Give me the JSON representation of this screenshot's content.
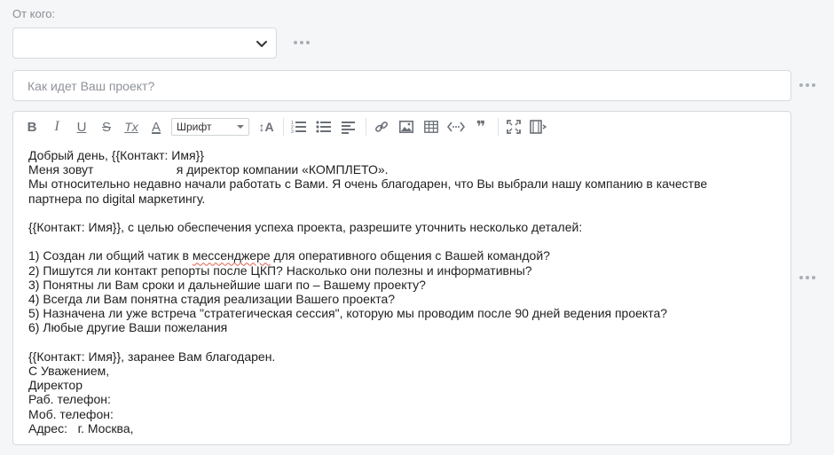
{
  "from": {
    "label": "От кого:",
    "value": ""
  },
  "subject": {
    "placeholder": "Как идет Ваш проект?",
    "value": ""
  },
  "toolbar": {
    "bold": "B",
    "italic": "I",
    "underline": "U",
    "strike": "S",
    "clear_format": "Tx",
    "font_color": "A",
    "font_select": "Шрифт",
    "font_size": "↕A",
    "quote": "❞"
  },
  "editor": {
    "lines": [
      "Добрый день, {{Контакт: Имя}}",
      "Меня зовут                        я директор компании «КОМПЛЕТО».",
      "Мы относительно недавно начали работать с Вами. Я очень благодарен, что Вы выбрали нашу компанию в качестве",
      "партнера по digital маркетингу.",
      "",
      "{{Контакт: Имя}}, с целью обеспечения успеха проекта, разрешите уточнить несколько деталей:",
      "",
      "1) Создан ли общий чатик в ",
      "2) Пишутся ли контакт репорты после ЦКП? Насколько они полезны и информативны?",
      "3) Понятны ли Вам сроки и дальнейшие шаги по – Вашему проекту?",
      "4) Всегда ли Вам понятна стадия реализации Вашего проекта?",
      "5) Назначена ли уже встреча \"стратегическая сессия\", которую мы проводим после 90 дней ведения проекта?",
      "6) Любые другие Ваши пожелания",
      "",
      "{{Контакт: Имя}}, заранее Вам благодарен.",
      "С Уважением,",
      "Директор",
      "Раб. телефон:",
      "Моб. телефон:",
      "Адрес:   г. Москва,"
    ],
    "line7_misspelled": "мессенджере",
    "line7_tail": " для оперативного общения с Вашей командой?"
  }
}
